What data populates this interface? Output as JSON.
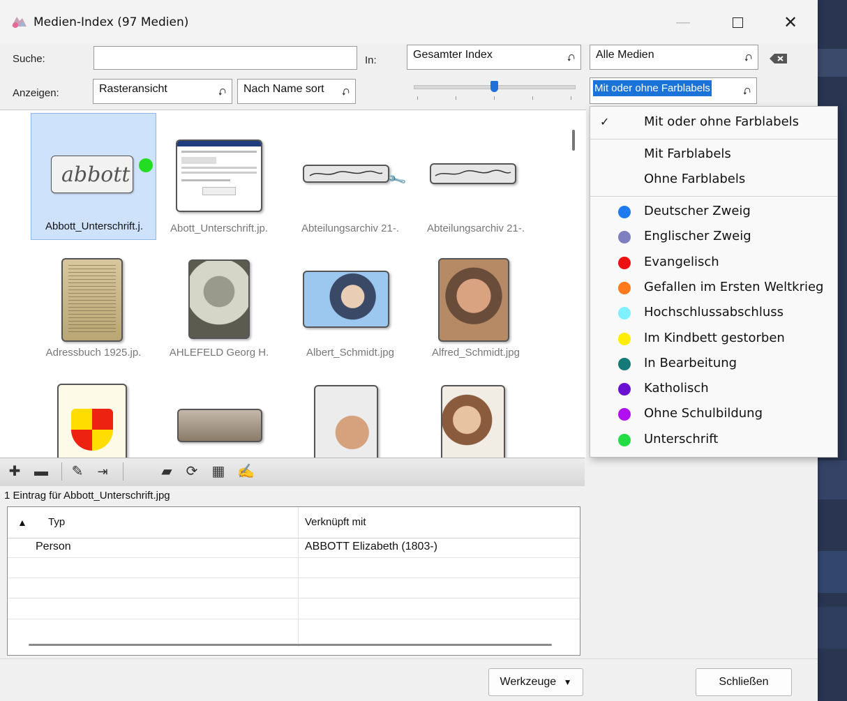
{
  "window": {
    "title": "Medien-Index (97 Medien)"
  },
  "search": {
    "label": "Suche:",
    "value": "",
    "in_label": "In:",
    "scope": "Gesamter Index",
    "media_filter": "Alle Medien"
  },
  "display": {
    "label": "Anzeigen:",
    "view_mode": "Rasteransicht",
    "sort": "Nach Name sort",
    "label_filter": "Mit oder ohne Farblabels"
  },
  "grid": {
    "items": [
      {
        "caption": "Abbott_Unterschrift.j."
      },
      {
        "caption": "Abott_Unterschrift.jp."
      },
      {
        "caption": "Abteilungsarchiv 21-."
      },
      {
        "caption": "Abteilungsarchiv 21-."
      },
      {
        "caption": "Adressbuch 1925.jp."
      },
      {
        "caption": "AHLEFELD Georg H."
      },
      {
        "caption": "Albert_Schmidt.jpg"
      },
      {
        "caption": "Alfred_Schmidt.jpg"
      },
      {
        "caption": ""
      },
      {
        "caption": ""
      },
      {
        "caption": ""
      },
      {
        "caption": ""
      }
    ],
    "selected_label_color": "#22dd22"
  },
  "toolbar": {
    "icons": [
      "plus-icon",
      "minus-icon",
      "pencil-icon",
      "merge-arrows-icon",
      "folder-icon",
      "refresh-icon",
      "save-icon",
      "edit-note-icon"
    ]
  },
  "entries": {
    "summary": "1 Eintrag für Abbott_Unterschrift.jpg",
    "columns": [
      "Typ",
      "Verknüpft mit"
    ],
    "rows": [
      {
        "type": "Person",
        "linked": "ABBOTT Elizabeth (1803-)"
      }
    ]
  },
  "label_menu": {
    "checked": "Mit oder ohne Farblabels",
    "options": [
      "Mit Farblabels",
      "Ohne Farblabels"
    ],
    "labels": [
      {
        "name": "Deutscher Zweig",
        "color": "#1e7bf0"
      },
      {
        "name": "Englischer Zweig",
        "color": "#7f7fc0"
      },
      {
        "name": "Evangelisch",
        "color": "#ee1111"
      },
      {
        "name": "Gefallen im Ersten Weltkrieg",
        "color": "#ff7a1a"
      },
      {
        "name": "Hochschlussabschluss",
        "color": "#7ff0ff"
      },
      {
        "name": "Im Kindbett gestorben",
        "color": "#ffee00"
      },
      {
        "name": "In Bearbeitung",
        "color": "#137a78"
      },
      {
        "name": "Katholisch",
        "color": "#6a10d0"
      },
      {
        "name": "Ohne Schulbildung",
        "color": "#b010f0"
      },
      {
        "name": "Unterschrift",
        "color": "#22dd44"
      }
    ]
  },
  "footer": {
    "tools_label": "Werkzeuge",
    "close_label": "Schließen"
  }
}
